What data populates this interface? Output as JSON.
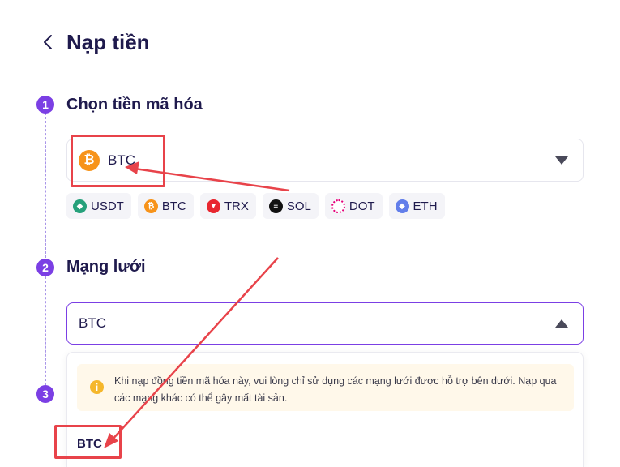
{
  "header": {
    "title": "Nạp tiền"
  },
  "steps": [
    {
      "number": "1",
      "title": "Chọn tiền mã hóa"
    },
    {
      "number": "2",
      "title": "Mạng lưới"
    },
    {
      "number": "3",
      "title": ""
    }
  ],
  "coin_select": {
    "value": "BTC",
    "icon": "bitcoin-icon"
  },
  "coin_chips": [
    {
      "label": "USDT",
      "icon": "tether-icon",
      "color": "#26a17b"
    },
    {
      "label": "BTC",
      "icon": "bitcoin-icon",
      "color": "#f7931a"
    },
    {
      "label": "TRX",
      "icon": "tron-icon",
      "color": "#e8262f"
    },
    {
      "label": "SOL",
      "icon": "solana-icon",
      "color": "#111111"
    },
    {
      "label": "DOT",
      "icon": "polkadot-icon",
      "color": "#e6007a"
    },
    {
      "label": "ETH",
      "icon": "ethereum-icon",
      "color": "#627eea"
    }
  ],
  "network_select": {
    "value": "BTC"
  },
  "dropdown": {
    "warning": "Khi nạp đồng tiền mã hóa này, vui lòng chỉ sử dụng các mạng lưới được hỗ trợ bên dưới. Nạp qua các mạng khác có thể gây mất tài sản.",
    "options": [
      "BTC"
    ]
  },
  "colors": {
    "accent": "#7b3fe4",
    "highlight": "#e8434a",
    "warning_bg": "#fff8ea"
  }
}
